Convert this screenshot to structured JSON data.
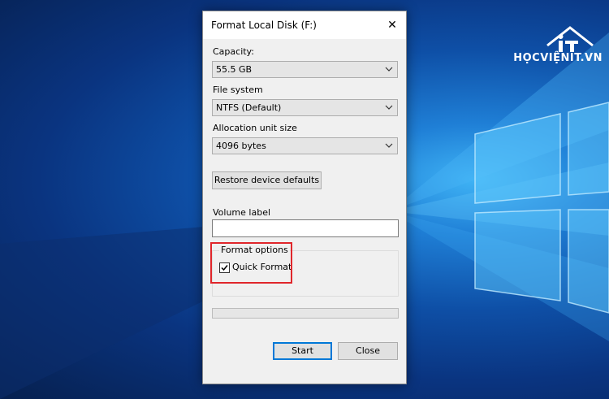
{
  "dialog": {
    "title": "Format Local Disk (F:)",
    "capacity_label": "Capacity:",
    "capacity_value": "55.5 GB",
    "filesystem_label": "File system",
    "filesystem_value": "NTFS (Default)",
    "allocation_label": "Allocation unit size",
    "allocation_value": "4096 bytes",
    "restore_button": "Restore device defaults",
    "volume_label": "Volume label",
    "volume_value": "",
    "format_options_title": "Format options",
    "quick_format_label": "Quick Format",
    "quick_format_checked": true,
    "progress": 0,
    "start_button": "Start",
    "close_button": "Close"
  },
  "watermark": {
    "text": "HỌCVIỆNIT.VN"
  },
  "colors": {
    "highlight": "#e0262b",
    "default_button_border": "#0078d7"
  }
}
